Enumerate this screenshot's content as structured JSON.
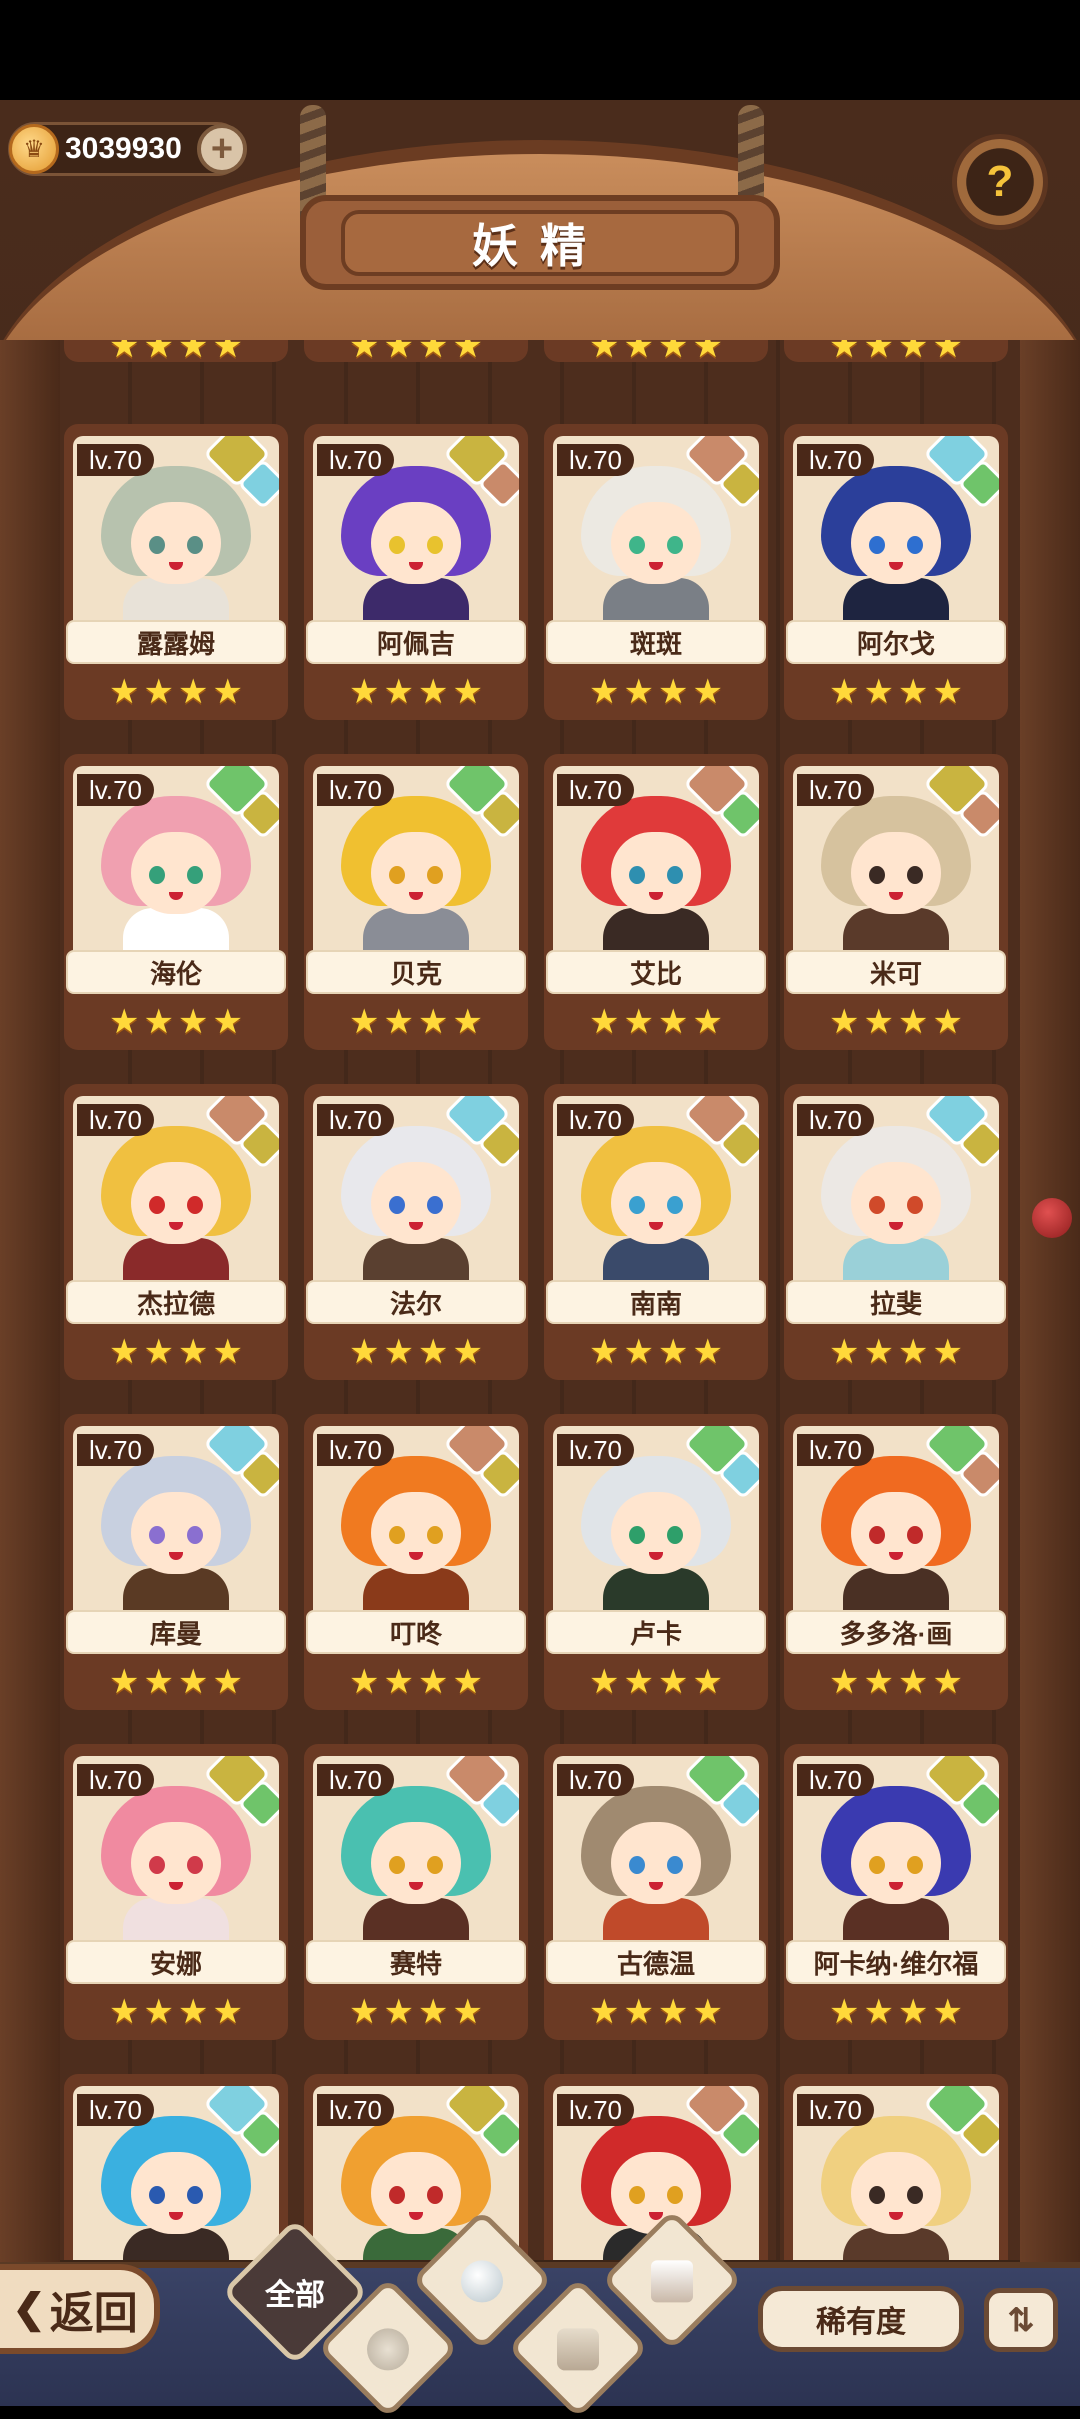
{
  "header": {
    "title": "妖精",
    "coins": "3039930",
    "coin_icon": "crown-coin-icon",
    "add_icon": "plus-icon",
    "help_icon": "question-sprout-icon"
  },
  "cards": [
    {
      "level": "lv.70",
      "name": "露露姆",
      "stars": 4,
      "hair": "#b7c2ae",
      "eye": "#5a8f86",
      "outfit": "#e8e2d8",
      "badge1": "#c9b440",
      "badge2": "#7fd0e0"
    },
    {
      "level": "lv.70",
      "name": "阿佩吉",
      "stars": 4,
      "hair": "#6a3fc2",
      "eye": "#e8c22e",
      "outfit": "#3d2a6a",
      "badge1": "#c9b440",
      "badge2": "#c98a6a"
    },
    {
      "level": "lv.70",
      "name": "斑斑",
      "stars": 4,
      "hair": "#ece9e2",
      "eye": "#3fb58a",
      "outfit": "#7a7f86",
      "badge1": "#c98a6a",
      "badge2": "#c9b440"
    },
    {
      "level": "lv.70",
      "name": "阿尔戈",
      "stars": 4,
      "hair": "#2b3f9a",
      "eye": "#2e6fd0",
      "outfit": "#1e2440",
      "badge1": "#7fd0e0",
      "badge2": "#6fc46a"
    },
    {
      "level": "lv.70",
      "name": "海伦",
      "stars": 4,
      "hair": "#f0a0b0",
      "eye": "#35a07a",
      "outfit": "#ffffff",
      "badge1": "#6fc46a",
      "badge2": "#c9b440"
    },
    {
      "level": "lv.70",
      "name": "贝克",
      "stars": 4,
      "hair": "#f0c030",
      "eye": "#e0a020",
      "outfit": "#8a8d96",
      "badge1": "#6fc46a",
      "badge2": "#c9b440"
    },
    {
      "level": "lv.70",
      "name": "艾比",
      "stars": 4,
      "hair": "#e03a3a",
      "eye": "#2e8fb0",
      "outfit": "#3a2a24",
      "badge1": "#c98a6a",
      "badge2": "#6fc46a"
    },
    {
      "level": "lv.70",
      "name": "米可",
      "stars": 4,
      "hair": "#d6c29e",
      "eye": "#3a2a24",
      "outfit": "#5a3a2a",
      "badge1": "#c9b440",
      "badge2": "#c98a6a"
    },
    {
      "level": "lv.70",
      "name": "杰拉德",
      "stars": 4,
      "hair": "#f0c040",
      "eye": "#d02a2a",
      "outfit": "#8a2a2a",
      "badge1": "#c98a6a",
      "badge2": "#c9b440"
    },
    {
      "level": "lv.70",
      "name": "法尔",
      "stars": 4,
      "hair": "#e8e8ec",
      "eye": "#3a6fd0",
      "outfit": "#5a4030",
      "badge1": "#7fd0e0",
      "badge2": "#c9b440"
    },
    {
      "level": "lv.70",
      "name": "南南",
      "stars": 4,
      "hair": "#f0c040",
      "eye": "#3aa0d0",
      "outfit": "#3a4a6a",
      "badge1": "#c98a6a",
      "badge2": "#c9b440"
    },
    {
      "level": "lv.70",
      "name": "拉斐",
      "stars": 4,
      "hair": "#ece8e4",
      "eye": "#d04a2a",
      "outfit": "#9ad0d8",
      "badge1": "#7fd0e0",
      "badge2": "#c9b440"
    },
    {
      "level": "lv.70",
      "name": "库曼",
      "stars": 4,
      "hair": "#c8d0e0",
      "eye": "#8a6fd0",
      "outfit": "#5a3a24",
      "badge1": "#7fd0e0",
      "badge2": "#c9b440"
    },
    {
      "level": "lv.70",
      "name": "叮咚",
      "stars": 4,
      "hair": "#f07a20",
      "eye": "#e0a020",
      "outfit": "#8a3a1a",
      "badge1": "#c98a6a",
      "badge2": "#c9b440"
    },
    {
      "level": "lv.70",
      "name": "卢卡",
      "stars": 4,
      "hair": "#e0e4e8",
      "eye": "#2e9f6a",
      "outfit": "#2a3a2a",
      "badge1": "#6fc46a",
      "badge2": "#7fd0e0"
    },
    {
      "level": "lv.70",
      "name": "多多洛·画",
      "stars": 4,
      "hair": "#f06a20",
      "eye": "#c02a2a",
      "outfit": "#4a3024",
      "badge1": "#6fc46a",
      "badge2": "#c98a6a"
    },
    {
      "level": "lv.70",
      "name": "安娜",
      "stars": 4,
      "hair": "#f08aa0",
      "eye": "#d03a4a",
      "outfit": "#f0e0e0",
      "badge1": "#c9b440",
      "badge2": "#6fc46a"
    },
    {
      "level": "lv.70",
      "name": "赛特",
      "stars": 4,
      "hair": "#4ac0b0",
      "eye": "#e0a020",
      "outfit": "#5a3024",
      "badge1": "#c98a6a",
      "badge2": "#7fd0e0"
    },
    {
      "level": "lv.70",
      "name": "古德温",
      "stars": 4,
      "hair": "#a08a70",
      "eye": "#3a8ad0",
      "outfit": "#c04a2a",
      "badge1": "#6fc46a",
      "badge2": "#7fd0e0"
    },
    {
      "level": "lv.70",
      "name": "阿卡纳·维尔福",
      "stars": 4,
      "hair": "#3a3ab0",
      "eye": "#e0a020",
      "outfit": "#5a3024",
      "badge1": "#c9b440",
      "badge2": "#6fc46a"
    },
    {
      "level": "lv.70",
      "name": "",
      "stars": 0,
      "hair": "#3ab0e0",
      "eye": "#2a5ab0",
      "outfit": "#3a2a24",
      "badge1": "#7fd0e0",
      "badge2": "#6fc46a"
    },
    {
      "level": "lv.70",
      "name": "",
      "stars": 0,
      "hair": "#f0a030",
      "eye": "#c02a2a",
      "outfit": "#3a6a3a",
      "badge1": "#c9b440",
      "badge2": "#6fc46a"
    },
    {
      "level": "lv.70",
      "name": "",
      "stars": 0,
      "hair": "#d02a2a",
      "eye": "#e0a020",
      "outfit": "#2a2a2a",
      "badge1": "#c98a6a",
      "badge2": "#6fc46a"
    },
    {
      "level": "lv.70",
      "name": "",
      "stars": 0,
      "hair": "#f0d080",
      "eye": "#3a2a24",
      "outfit": "#5a3a2a",
      "badge1": "#6fc46a",
      "badge2": "#c9b440"
    }
  ],
  "bottom": {
    "back_label": "返回",
    "back_icon": "chevron-left-icon",
    "filter_all_label": "全部",
    "filter_icons": [
      "water-drop-icon",
      "mountain-icon",
      "sprout-icon",
      "rock-icon"
    ],
    "sort_label": "稀有度",
    "order_icon": "sort-order-icon"
  }
}
